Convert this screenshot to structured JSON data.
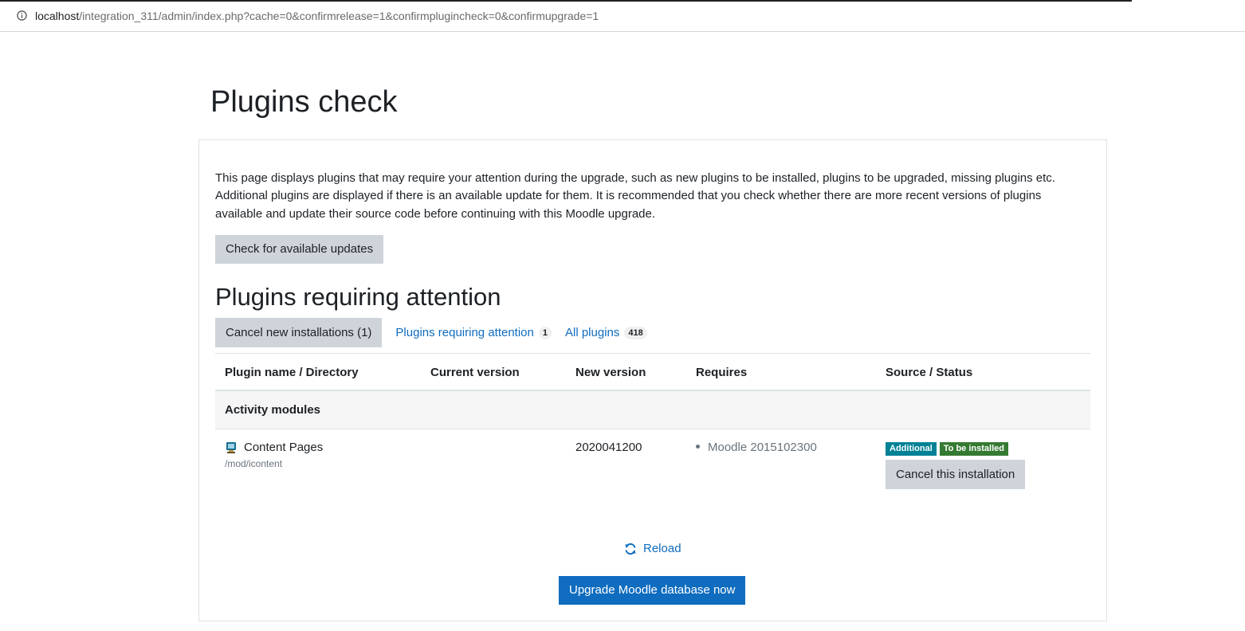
{
  "browser": {
    "url_host": "localhost",
    "url_path": "/integration_311/admin/index.php?cache=0&confirmrelease=1&confirmplugincheck=0&confirmupgrade=1"
  },
  "page": {
    "title": "Plugins check",
    "intro": "This page displays plugins that may require your attention during the upgrade, such as new plugins to be installed, plugins to be upgraded, missing plugins etc. Additional plugins are displayed if there is an available update for them. It is recommended that you check whether there are more recent versions of plugins available and update their source code before continuing with this Moodle upgrade.",
    "check_updates_label": "Check for available updates",
    "section_title": "Plugins requiring attention"
  },
  "tabs": {
    "cancel_new_label": "Cancel new installations (1)",
    "attention_label": "Plugins requiring attention",
    "attention_count": "1",
    "all_label": "All plugins",
    "all_count": "418"
  },
  "table": {
    "headers": [
      "Plugin name / Directory",
      "Current version",
      "New version",
      "Requires",
      "Source / Status"
    ],
    "groups": [
      {
        "name": "Activity modules",
        "plugins": [
          {
            "name": "Content Pages",
            "directory": "/mod/icontent",
            "current_version": "",
            "new_version": "2020041200",
            "requires": "Moodle 2015102300",
            "source_badge": "Additional",
            "status_badge": "To be installed",
            "action_label": "Cancel this installation"
          }
        ]
      }
    ]
  },
  "footer": {
    "reload_label": "Reload",
    "upgrade_label": "Upgrade Moodle database now"
  },
  "colors": {
    "primary": "#0f6cbf",
    "secondary_btn": "#ced4da",
    "badge_info": "#008196",
    "badge_success": "#357a32"
  }
}
